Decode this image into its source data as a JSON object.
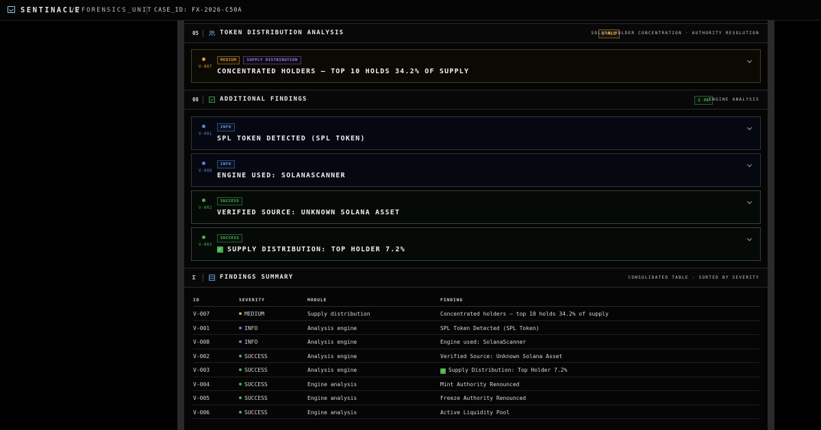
{
  "topbar": {
    "brand": "SENTINACLE",
    "brand_sub": "//FORENSICS_UNIT",
    "case_id": "CASE_ID: FX-2026-C50A"
  },
  "sections": {
    "distribution": {
      "number": "05",
      "title": "TOKEN DISTRIBUTION ANALYSIS",
      "badge": "1 MED",
      "right_text": "SOLANA HOLDER CONCENTRATION · AUTHORITY RESOLUTION"
    },
    "additional": {
      "number": "08",
      "title": "ADDITIONAL FINDINGS",
      "badge": "2 OK",
      "right_text": "ENGINE ANALYSIS"
    },
    "summary": {
      "number": "Σ",
      "title": "FINDINGS SUMMARY",
      "right_text": "CONSOLIDATED TABLE · SORTED BY SEVERITY"
    }
  },
  "cards": [
    {
      "id": "V-007",
      "severity": "MEDIUM",
      "module": "SUPPLY DISTRIBUTION",
      "title": "CONCENTRATED HOLDERS — TOP 10 HOLDS 34.2% OF SUPPLY"
    },
    {
      "id": "V-001",
      "severity": "INFO",
      "title": "SPL TOKEN DETECTED (SPL TOKEN)"
    },
    {
      "id": "V-008",
      "severity": "INFO",
      "title": "ENGINE USED: SOLANASCANNER"
    },
    {
      "id": "V-002",
      "severity": "SUCCESS",
      "title": "VERIFIED SOURCE: UNKNOWN SOLANA ASSET"
    },
    {
      "id": "V-003",
      "severity": "SUCCESS",
      "title": "SUPPLY DISTRIBUTION: TOP HOLDER 7.2%"
    }
  ],
  "table": {
    "headers": {
      "id": "ID",
      "severity": "SEVERITY",
      "module": "MODULE",
      "finding": "FINDING"
    },
    "rows": [
      {
        "id": "V-007",
        "severity": "MEDIUM",
        "module": "Supply distribution",
        "finding": "Concentrated holders — top 10 holds 34.2% of supply"
      },
      {
        "id": "V-001",
        "severity": "INFO",
        "module": "Analysis engine",
        "finding": "SPL Token Detected (SPL Token)"
      },
      {
        "id": "V-008",
        "severity": "INFO",
        "module": "Analysis engine",
        "finding": "Engine used: SolanaScanner"
      },
      {
        "id": "V-002",
        "severity": "SUCCESS",
        "module": "Analysis engine",
        "finding": "Verified Source: Unknown Solana Asset"
      },
      {
        "id": "V-003",
        "severity": "SUCCESS",
        "module": "Analysis engine",
        "finding": "Supply Distribution: Top Holder 7.2%"
      },
      {
        "id": "V-004",
        "severity": "SUCCESS",
        "module": "Engine analysis",
        "finding": "Mint Authority Renounced"
      },
      {
        "id": "V-005",
        "severity": "SUCCESS",
        "module": "Engine analysis",
        "finding": "Freeze Authority Renounced"
      },
      {
        "id": "V-006",
        "severity": "SUCCESS",
        "module": "Engine analysis",
        "finding": "Active Liquidity Pool"
      }
    ]
  },
  "colors": {
    "medium": "#e0a23a",
    "info": "#5a86d6",
    "success": "#4caf50",
    "module_tag": "#a88cd8"
  }
}
